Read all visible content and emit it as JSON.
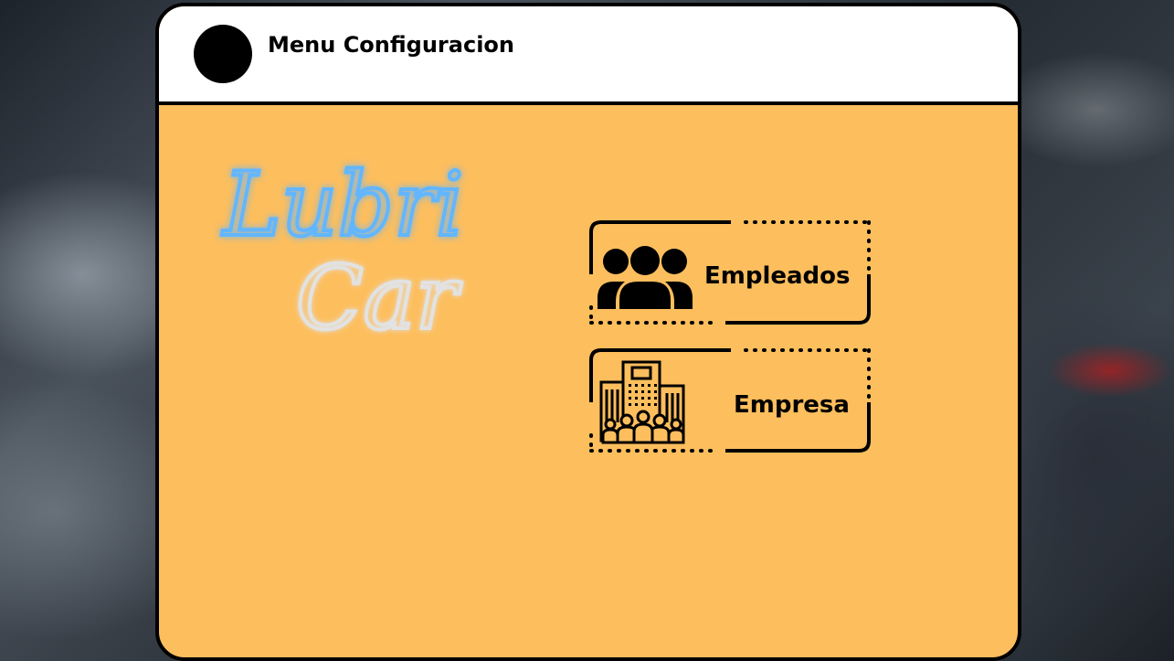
{
  "window": {
    "title": "Menu Configuracion"
  },
  "logo": {
    "line1": "Lubri",
    "line2": "Car"
  },
  "menu": {
    "items": [
      {
        "label": "Empleados",
        "icon": "people-group-icon"
      },
      {
        "label": "Empresa",
        "icon": "company-building-icon"
      }
    ]
  },
  "colors": {
    "panel": "#fdbe5d",
    "header": "#ffffff",
    "logo_blue": "#62b6ff",
    "logo_grey": "#e2e2e2"
  }
}
